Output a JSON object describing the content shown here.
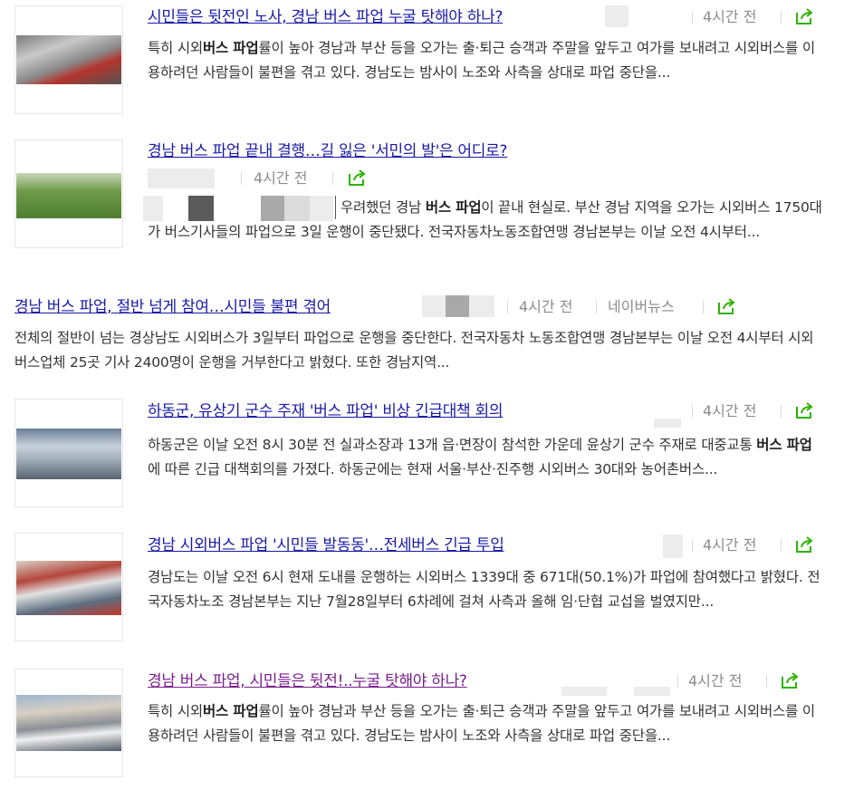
{
  "articles": [
    {
      "title": "시민들은 뒷전인 노사, 경남 버스 파업 누굴 탓해야 하나?",
      "time": "4시간 전",
      "desc_pre": "특히 시외",
      "desc_bold1": "버스 파업",
      "desc_post": "률이 높아 경남과 부산 등을 오가는 출·퇴근 승객과 주말을 앞두고 여가를 보내려고 시외버스를 이용하려던 사람들이 불편을 겪고 있다. 경남도는 밤사이 노조와 사측을 상대로 파업 중단을..."
    },
    {
      "title": "경남 버스 파업 끝내 결행…길 잃은 '서민의 발'은 어디로?",
      "time": "4시간 전",
      "desc_pre": "우려했던 경남 ",
      "desc_bold1": "버스 파업",
      "desc_post": "이 끝내 현실로. 부산 경남 지역을 오가는 시외버스 1750대가 버스기사들의 파업으로 3일 운행이 중단됐다. 전국자동차노동조합연맹 경남본부는 이날 오전 4시부터..."
    },
    {
      "title": "경남 버스 파업, 절반 넘게 참여…시민들 불편 겪어",
      "time": "4시간 전",
      "source": "네이버뉴스",
      "desc": "전체의 절반이 넘는 경상남도 시외버스가 3일부터 파업으로 운행을 중단한다. 전국자동차 노동조합연맹 경남본부는 이날 오전 4시부터 시외버스업체 25곳 기사 2400명이 운행을 거부한다고 밝혔다. 또한 경남지역..."
    },
    {
      "title": "하동군, 유상기 군수 주재 '버스 파업' 비상 긴급대책 회의",
      "time": "4시간 전",
      "desc_pre": "하동군은 이날 오전 8시 30분 전 실과소장과 13개 읍·면장이 참석한 가운데 윤상기 군수 주재로 대중교통 ",
      "desc_bold1": "버스 파업",
      "desc_post": "에 따른 긴급 대책회의를 가졌다. 하동군에는 현재 서울·부산·진주행 시외버스 30대와 농어촌버스..."
    },
    {
      "title": "경남 시외버스 파업 '시민들 발동동'…전세버스 긴급 투입",
      "time": "4시간 전",
      "desc": "경남도는 이날 오전 6시 현재 도내를 운행하는 시외버스 1339대 중 671대(50.1%)가 파업에 참여했다고 밝혔다.   전국자동차노조 경남본부는 지난 7월28일부터 6차례에 걸쳐 사측과 올해 임·단협 교섭을 벌였지만..."
    },
    {
      "title": "경남 버스 파업, 시민들은 뒷전!..누굴 탓해야 하나?",
      "time": "4시간 전",
      "desc_pre": "특히 시외",
      "desc_bold1": "버스 파업",
      "desc_post": "률이 높아 경남과 부산 등을 오가는 출·퇴근 승객과 주말을 앞두고 여가를 보내려고 시외버스를 이용하려던 사람들이 불편을 겪고 있다. 경남도는 밤사이 노조와 사측을 상대로 파업 중단을..."
    }
  ],
  "icons": {
    "share": "share-icon",
    "thumbnail": "news-thumbnail"
  },
  "colors": {
    "title": "#1a1aa6",
    "visited": "#7a1f8c",
    "share_green": "#2db400",
    "meta": "#8c8c8c"
  }
}
